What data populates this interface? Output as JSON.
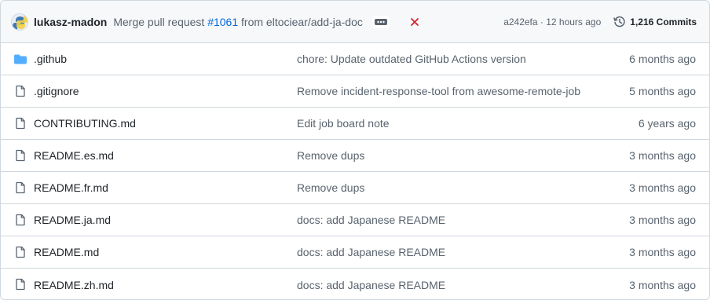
{
  "commit": {
    "author": "lukasz-madon",
    "message_prefix": "Merge pull request ",
    "pr_number": "#1061",
    "message_suffix": " from eltociear/add-ja-doc",
    "sha_time": "a242efa · 12 hours ago",
    "commits_count": "1,216 Commits",
    "status": "failure"
  },
  "colors": {
    "link": "#0969da",
    "muted": "#59636e",
    "folder": "#54aeff",
    "failure": "#cf222e",
    "border": "#d0d7de",
    "header_bg": "#f6f8fa"
  },
  "files": [
    {
      "name": ".github",
      "type": "folder",
      "icon": "folder-icon",
      "message": "chore: Update outdated GitHub Actions version",
      "age": "6 months ago"
    },
    {
      "name": ".gitignore",
      "type": "file",
      "icon": "file-icon",
      "message": "Remove incident-response-tool from awesome-remote-job",
      "age": "5 months ago"
    },
    {
      "name": "CONTRIBUTING.md",
      "type": "file",
      "icon": "file-icon",
      "message": "Edit job board note",
      "age": "6 years ago"
    },
    {
      "name": "README.es.md",
      "type": "file",
      "icon": "file-icon",
      "message": "Remove dups",
      "age": "3 months ago"
    },
    {
      "name": "README.fr.md",
      "type": "file",
      "icon": "file-icon",
      "message": "Remove dups",
      "age": "3 months ago"
    },
    {
      "name": "README.ja.md",
      "type": "file",
      "icon": "file-icon",
      "message": "docs: add Japanese README",
      "age": "3 months ago"
    },
    {
      "name": "README.md",
      "type": "file",
      "icon": "file-icon",
      "message": "docs: add Japanese README",
      "age": "3 months ago"
    },
    {
      "name": "README.zh.md",
      "type": "file",
      "icon": "file-icon",
      "message": "docs: add Japanese README",
      "age": "3 months ago"
    }
  ]
}
